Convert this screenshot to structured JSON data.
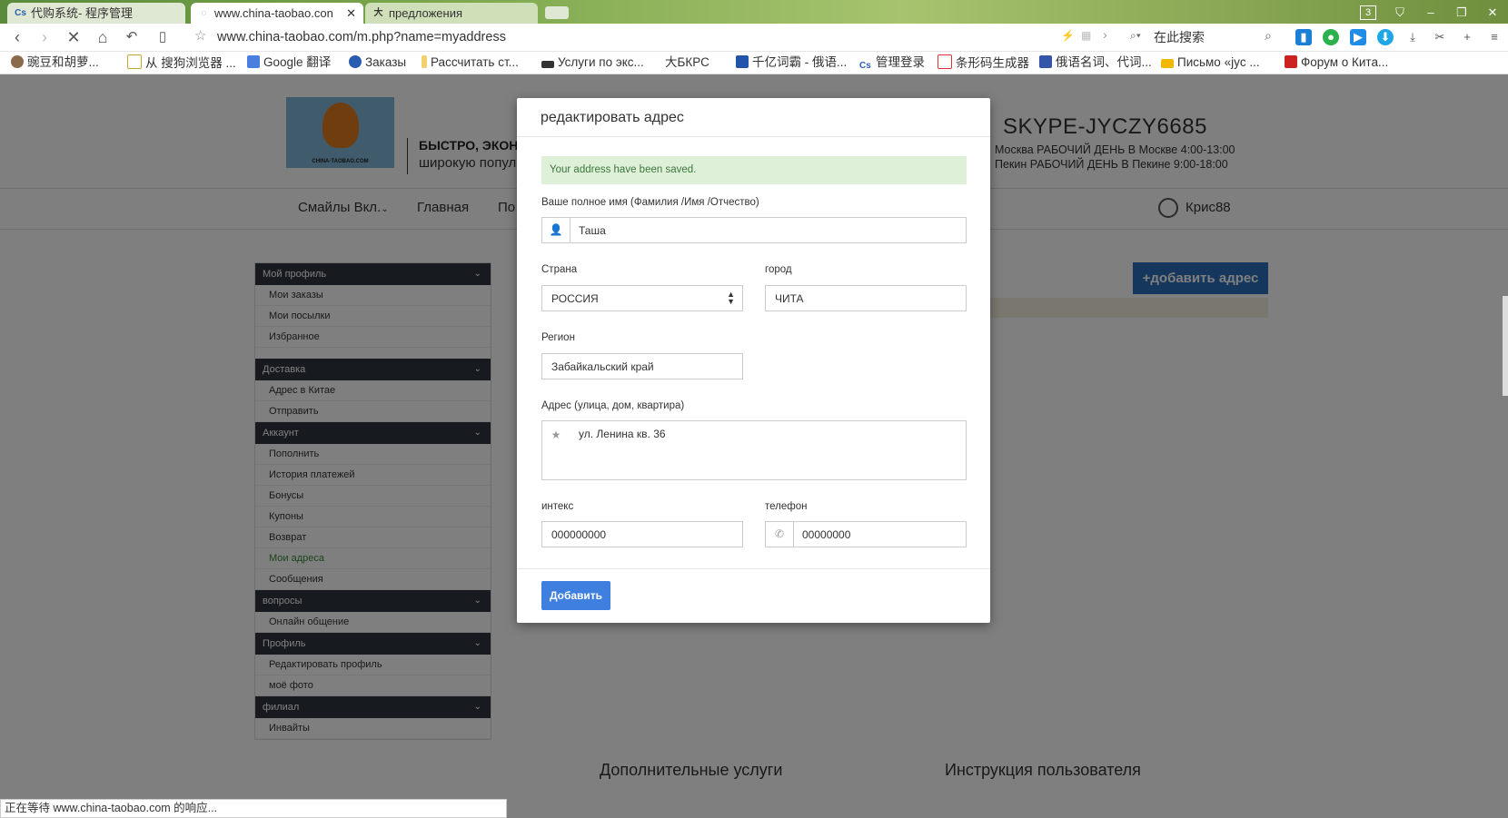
{
  "browser": {
    "tabs": [
      {
        "label": "代购系统- 程序管理",
        "favicon": "cs"
      },
      {
        "label": "www.china-taobao.con",
        "favicon": "loading"
      },
      {
        "label": "предложения",
        "favicon": "大"
      }
    ],
    "window_badge": "3",
    "url": "www.china-taobao.com/m.php?name=myaddress",
    "search_placeholder": "在此搜索",
    "bookmarks": [
      "豌豆和胡萝...",
      "从 搜狗浏览器 ...",
      "Google 翻译",
      "Заказы",
      "Рассчитать ст...",
      "Услуги по экс...",
      "大БКРС",
      "千亿词霸 - 俄语...",
      "管理登录",
      "条形码生成器",
      "俄语名词、代词...",
      "Письмо «jyc ...",
      "Форум о Кита..."
    ],
    "status_text": "正在等待 www.china-taobao.com 的响应..."
  },
  "header": {
    "logo_text": "CHINA-TAOBAO.COM",
    "slogan_line1": "БЫСТРО, ЭКОНС",
    "slogan_line2": "широкую попул",
    "skype": "SKYPE-JYCZY6685",
    "hours_moscow": "Москва  РАБОЧИЙ ДЕНЬ В Москве 4:00-13:00",
    "hours_beijing": "Пекин    РАБОЧИЙ ДЕНЬ В Пекине 9:00-18:00"
  },
  "menu": {
    "items": [
      "Смайлы Вкл.",
      "Главная",
      "По"
    ],
    "user": "Крис88"
  },
  "sidebar": {
    "sections": [
      {
        "title": "Мой профиль",
        "items": [
          "Мои заказы",
          "Мои посылки",
          "Избранное"
        ]
      },
      {
        "title": "Доставка",
        "items": [
          "Адрес в Китае",
          "Отправить"
        ]
      },
      {
        "title": "Аккаунт",
        "items": [
          "Пополнить",
          "История платежей",
          "Бонусы",
          "Купоны",
          "Возврат",
          "Мои адреса",
          "Сообщения"
        ]
      },
      {
        "title": "вопросы",
        "items": [
          "Онлайн общение"
        ]
      },
      {
        "title": "Профиль",
        "items": [
          "Редактировать профиль",
          "моё фото"
        ]
      },
      {
        "title": "филиал",
        "items": [
          "Инвайты"
        ]
      }
    ],
    "active_item": "Мои адреса"
  },
  "main": {
    "add_address_button": "+добавить адрес"
  },
  "footer": {
    "col1": "Дополнительные услуги",
    "col2": "Инструкция пользователя"
  },
  "modal": {
    "title": "редактировать адрес",
    "alert": "Your address have been saved.",
    "fullname_label": "Ваше полное имя (Фамилия /Имя /Отчество)",
    "fullname_value": "Таша",
    "country_label": "Страна",
    "country_value": "РОССИЯ",
    "city_label": "город",
    "city_value": "ЧИТА",
    "region_label": "Регион",
    "region_value": "Забайкальский край",
    "address_label": "Адрес (улица, дом, квартира)",
    "address_value": "ул. Ленина кв. 36",
    "zip_label": "интекс",
    "zip_value": "000000000",
    "phone_label": "телефон",
    "phone_value": "00000000",
    "submit_label": "Добавить"
  }
}
